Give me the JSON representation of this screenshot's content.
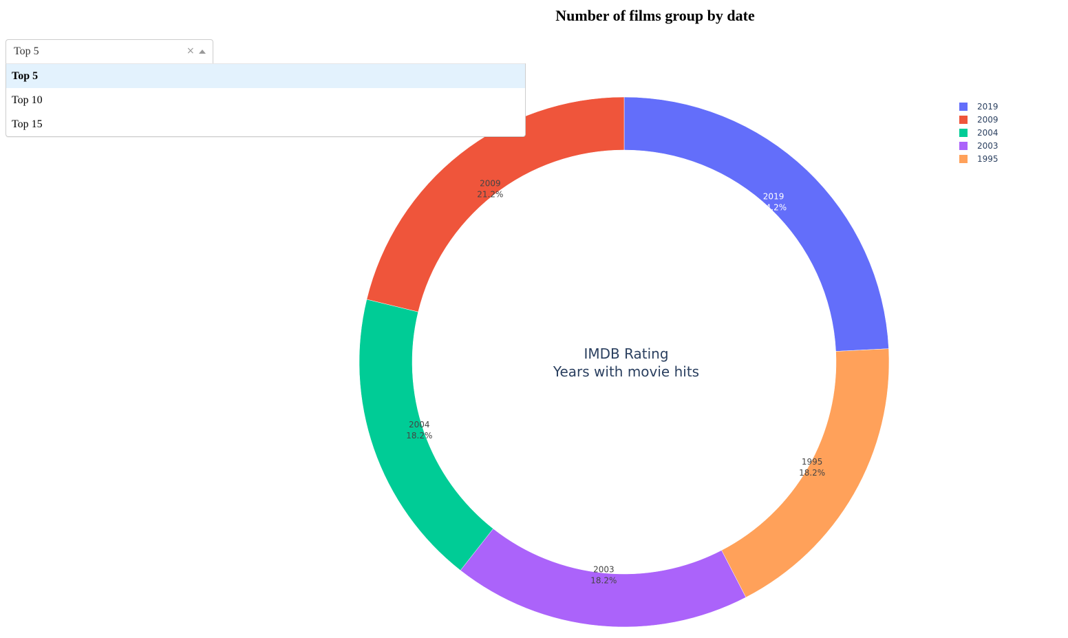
{
  "title": "Number of films group by date",
  "dropdown": {
    "value": "Top 5",
    "clear_glyph": "×",
    "options": [
      "Top 5",
      "Top 10",
      "Top 15"
    ],
    "selected_index": 0
  },
  "chart_data": {
    "type": "pie",
    "hole": true,
    "center_text": [
      "IMDB Rating",
      "Years with movie hits"
    ],
    "direction": "clockwise",
    "start": "top",
    "legend_position": "top-right",
    "slices": [
      {
        "label": "2019",
        "percent": "24.2%",
        "value": 24.2,
        "color": "#636efa"
      },
      {
        "label": "1995",
        "percent": "18.2%",
        "value": 18.2,
        "color": "#ffa15a"
      },
      {
        "label": "2003",
        "percent": "18.2%",
        "value": 18.2,
        "color": "#ab63fa"
      },
      {
        "label": "2004",
        "percent": "18.2%",
        "value": 18.2,
        "color": "#00cc96"
      },
      {
        "label": "2009",
        "percent": "21.2%",
        "value": 21.2,
        "color": "#ef553b"
      }
    ],
    "legend": [
      {
        "label": "2019",
        "color": "#636efa"
      },
      {
        "label": "2009",
        "color": "#ef553b"
      },
      {
        "label": "2004",
        "color": "#00cc96"
      },
      {
        "label": "2003",
        "color": "#ab63fa"
      },
      {
        "label": "1995",
        "color": "#ffa15a"
      }
    ],
    "label_text_colors": {
      "dark_bg": "#ffffff",
      "light_bg": "#444444"
    }
  }
}
